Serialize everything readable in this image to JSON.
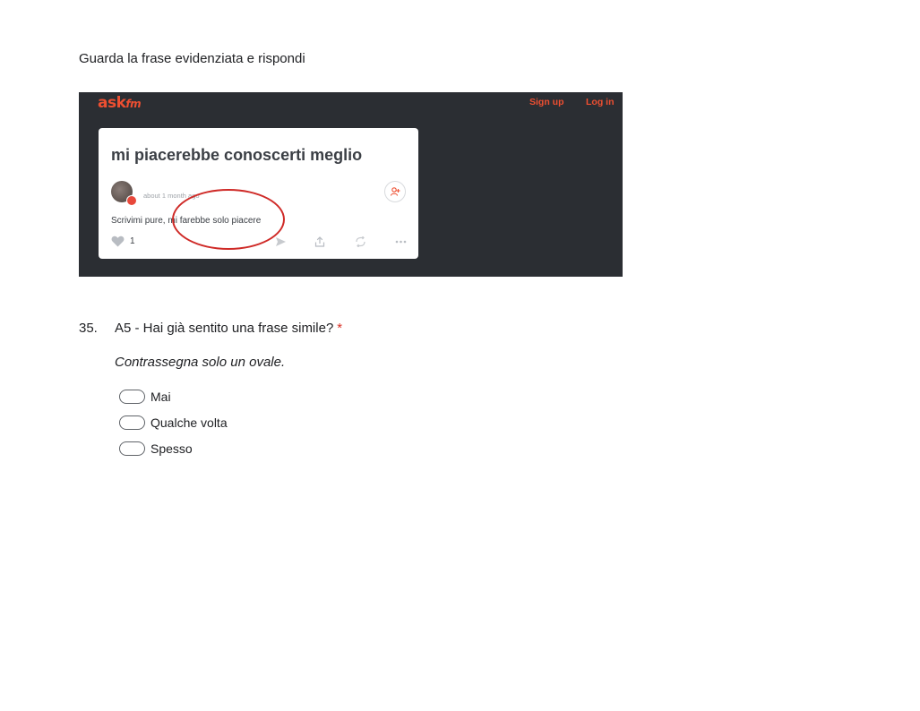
{
  "intro": {
    "text": "Guarda la frase evidenziata e rispondi"
  },
  "screenshot": {
    "logo_main": "ask",
    "logo_suffix": "fm",
    "nav_signup": "Sign up",
    "nav_login": "Log in",
    "question_title": "mi piacerebbe conoscerti meglio",
    "time_ago": "about 1 month ago",
    "answer_prefix": "Scrivimi pure,",
    "answer_highlighted": "mi farebbe solo piacere",
    "like_count": "1",
    "colors": {
      "background": "#2b2e33",
      "brand": "#ee4f31",
      "highlight_ring": "#cf2a27"
    },
    "icons": [
      "person-add-icon",
      "heart-icon",
      "share-icon",
      "upload-icon",
      "repeat-icon",
      "more-icon"
    ]
  },
  "question": {
    "number": "35.",
    "text": "A5 - Hai già sentito una frase simile?",
    "required_marker": "*",
    "hint": "Contrassegna solo un ovale.",
    "options": [
      {
        "label": "Mai",
        "selected": false
      },
      {
        "label": "Qualche volta",
        "selected": false
      },
      {
        "label": "Spesso",
        "selected": false
      }
    ]
  }
}
